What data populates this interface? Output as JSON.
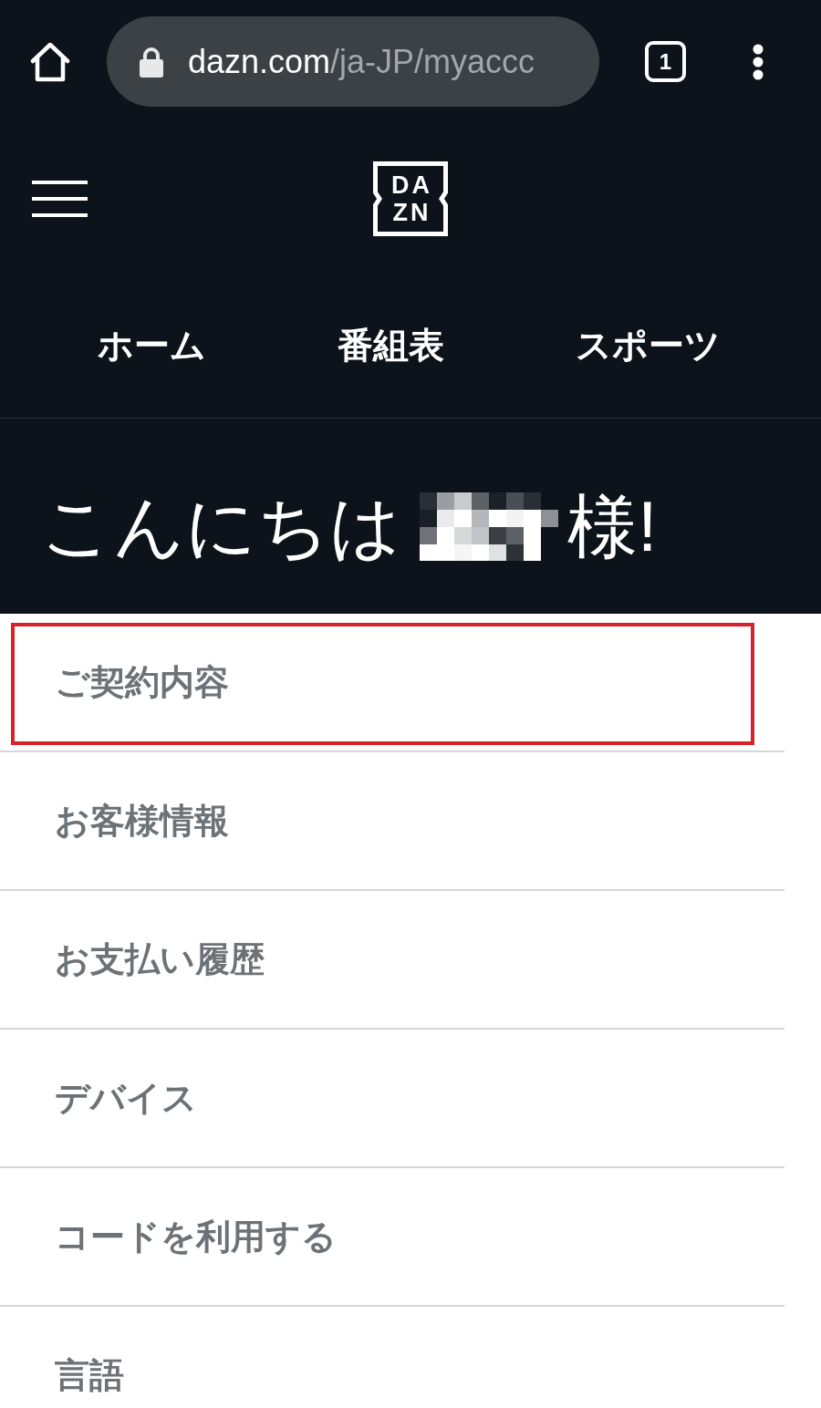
{
  "browser": {
    "url_host": "dazn.com",
    "url_path": "/ja-JP/myaccc",
    "tab_count": "1"
  },
  "header": {
    "logo_lines": [
      "DA",
      "ZN"
    ]
  },
  "nav": [
    "ホーム",
    "番組表",
    "スポーツ"
  ],
  "greeting": {
    "before": "こんにちは",
    "after": "様!"
  },
  "menu": [
    {
      "label": "ご契約内容",
      "highlighted": true
    },
    {
      "label": "お客様情報",
      "highlighted": false
    },
    {
      "label": "お支払い履歴",
      "highlighted": false
    },
    {
      "label": "デバイス",
      "highlighted": false
    },
    {
      "label": "コードを利用する",
      "highlighted": false
    },
    {
      "label": "言語",
      "highlighted": false
    }
  ]
}
